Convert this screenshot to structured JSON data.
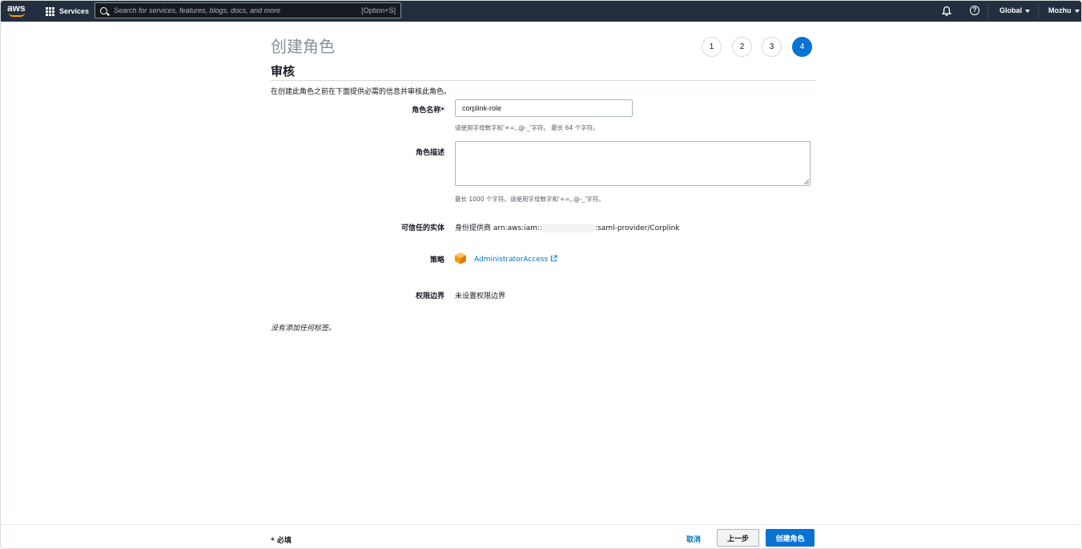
{
  "topnav": {
    "logo_text": "aws",
    "services_label": "Services",
    "search_placeholder": "Search for services, features, blogs, docs, and more",
    "search_shortcut": "[Option+S]",
    "region_label": "Global",
    "user_label": "Mozhu",
    "icons": [
      "grid-icon",
      "search-icon",
      "bell-icon",
      "help-icon"
    ]
  },
  "page": {
    "title": "创建角色",
    "steps": [
      {
        "label": "1",
        "active": false
      },
      {
        "label": "2",
        "active": false
      },
      {
        "label": "3",
        "active": false
      },
      {
        "label": "4",
        "active": true
      }
    ],
    "section_title": "审核",
    "intro": "在创建此角色之前在下面提供必需的信息并审核此角色。"
  },
  "form": {
    "role_name": {
      "label": "角色名称*",
      "value": "corplink-role",
      "hint": "请使用字母数字和'+=,.@-_'字符。 最长 64 个字符。"
    },
    "role_description": {
      "label": "角色描述",
      "value": "",
      "hint": "最长 1000 个字符。请使用字母数字和'+=,.@-_'字符。"
    },
    "trusted_entity": {
      "label": "可信任的实体",
      "prefix": "身份提供商 arn:aws:iam::",
      "suffix": ":saml-provider/Corplink"
    },
    "policy": {
      "label": "策略",
      "value": "AdministratorAccess",
      "icon": "policy-cube-icon",
      "icon_color": "#ff9900"
    },
    "boundary": {
      "label": "权限边界",
      "value": "未设置权限边界"
    },
    "no_tags": "没有添加任何标签。"
  },
  "footer": {
    "required_note": "* 必填",
    "cancel_label": "取消",
    "previous_label": "上一步",
    "create_label": "创建角色",
    "primary_color": "#0972d3"
  }
}
